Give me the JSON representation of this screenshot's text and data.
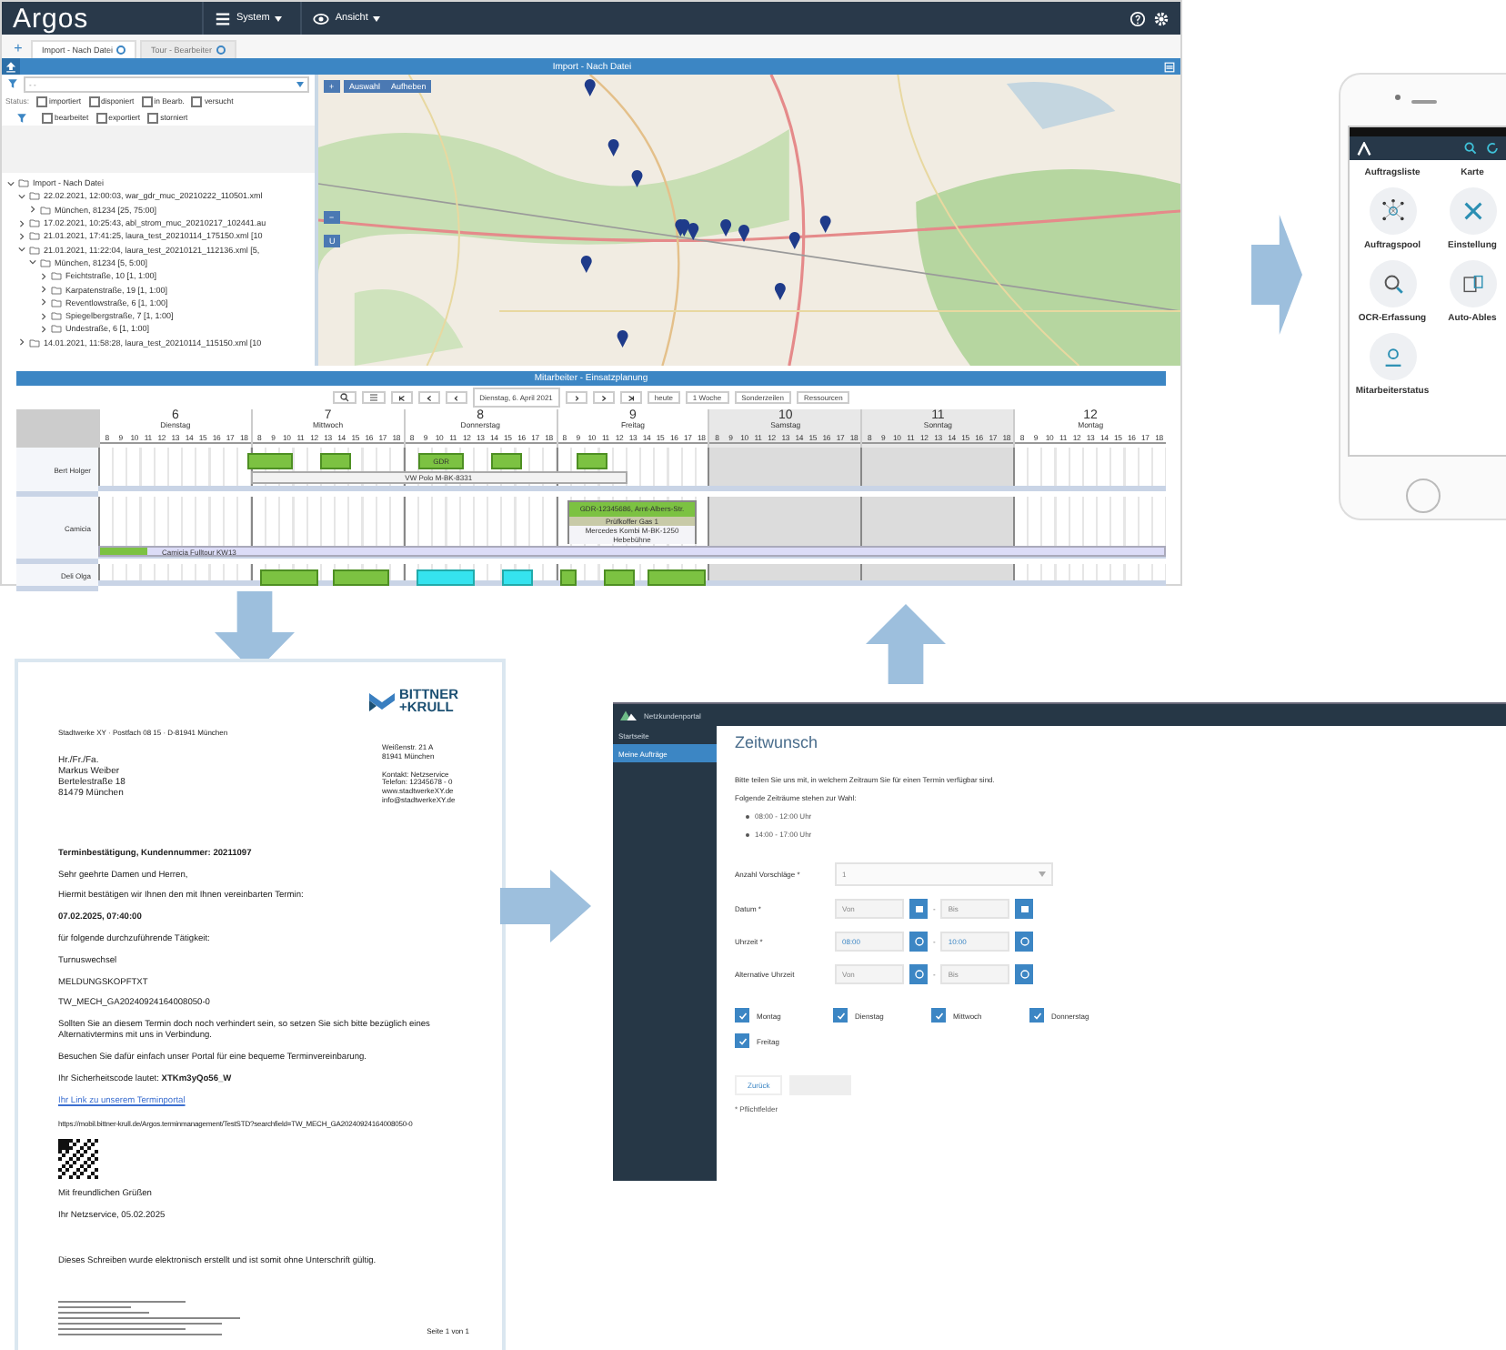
{
  "argos": {
    "logo": "Argos",
    "menus": [
      {
        "label": "System"
      },
      {
        "label": "Ansicht"
      }
    ],
    "add_tab": "+",
    "tabs": [
      {
        "label": "Import - Nach Datei",
        "selected": true
      },
      {
        "label": "Tour - Bearbeiter",
        "selected": false
      }
    ],
    "import_panel": {
      "title": "Import - Nach Datei",
      "filter_value": "- -",
      "status_label": "Status:",
      "statuses": [
        {
          "label": "importiert",
          "checked": false
        },
        {
          "label": "disponiert",
          "checked": false
        },
        {
          "label": "in Bearb.",
          "checked": false
        },
        {
          "label": "versucht",
          "checked": false
        },
        {
          "label": "bearbeitet",
          "checked": false
        },
        {
          "label": "exportiert",
          "checked": false
        },
        {
          "label": "storniert",
          "checked": false
        }
      ],
      "tree": [
        {
          "label": "Import - Nach Datei",
          "expanded": true,
          "children": [
            {
              "label": "22.02.2021, 12:00:03, war_gdr_muc_20210222_110501.xml",
              "expanded": true,
              "children": [
                {
                  "label": "München, 81234 [25, 75:00]",
                  "expanded": false
                }
              ]
            },
            {
              "label": "17.02.2021, 10:25:43, abl_strom_muc_20210217_102441.au",
              "expanded": false
            },
            {
              "label": "21.01.2021, 17:41:25, laura_test_20210114_175150.xml [10",
              "expanded": false
            },
            {
              "label": "21.01.2021, 11:22:04, laura_test_20210121_112136.xml [5,",
              "expanded": true,
              "children": [
                {
                  "label": "München, 81234 [5, 5:00]",
                  "expanded": true,
                  "children": [
                    {
                      "label": "Feichtstraße, 10 [1, 1:00]",
                      "expanded": false
                    },
                    {
                      "label": "Karpatenstraße, 19 [1, 1:00]",
                      "expanded": false
                    },
                    {
                      "label": "Reventlowstraße, 6 [1, 1:00]",
                      "expanded": false
                    },
                    {
                      "label": "Spiegelbergstraße, 7 [1, 1:00]",
                      "expanded": false
                    },
                    {
                      "label": "Undestraße, 6 [1, 1:00]",
                      "expanded": false
                    }
                  ]
                }
              ]
            },
            {
              "label": "14.01.2021, 11:58:28, laura_test_20210114_115150.xml [10",
              "expanded": false
            }
          ]
        }
      ]
    },
    "map": {
      "zoom_in": "+",
      "zoom_out": "−",
      "buttons": [
        "Auswahl",
        "Aufheben"
      ],
      "u_button": "U"
    },
    "planning": {
      "title": "Mitarbeiter - Einsatzplanung",
      "date": "Dienstag, 6. April 2021",
      "buttons": [
        "heute",
        "1 Woche",
        "Sonderzeilen",
        "Ressourcen"
      ],
      "days": [
        {
          "number": "6",
          "name": "Dienstag",
          "weekend": false,
          "hours": [
            "8",
            "9",
            "10",
            "11",
            "12",
            "13",
            "14",
            "15",
            "16",
            "17",
            "18"
          ]
        },
        {
          "number": "7",
          "name": "Mittwoch",
          "weekend": false,
          "hours": [
            "8",
            "9",
            "10",
            "11",
            "12",
            "13",
            "14",
            "15",
            "16",
            "17",
            "18"
          ]
        },
        {
          "number": "8",
          "name": "Donnerstag",
          "weekend": false,
          "hours": [
            "8",
            "9",
            "10",
            "11",
            "12",
            "13",
            "14",
            "15",
            "16",
            "17",
            "18"
          ]
        },
        {
          "number": "9",
          "name": "Freitag",
          "weekend": false,
          "hours": [
            "8",
            "9",
            "10",
            "11",
            "12",
            "13",
            "14",
            "15",
            "16",
            "17",
            "18"
          ]
        },
        {
          "number": "10",
          "name": "Samstag",
          "weekend": true,
          "hours": [
            "8",
            "9",
            "10",
            "11",
            "12",
            "13",
            "14",
            "15",
            "16",
            "17",
            "18"
          ]
        },
        {
          "number": "11",
          "name": "Sonntag",
          "weekend": true,
          "hours": [
            "8",
            "9",
            "10",
            "11",
            "12",
            "13",
            "14",
            "15",
            "16",
            "17",
            "18"
          ]
        },
        {
          "number": "12",
          "name": "Montag",
          "weekend": false,
          "hours": [
            "8",
            "9",
            "10",
            "11",
            "12",
            "13",
            "14",
            "15",
            "16",
            "17",
            "18"
          ]
        }
      ],
      "rows": [
        {
          "name": "Bert Holger",
          "kind": "short",
          "lanes": [
            [
              [
                {
                  "kind": "free"
                },
                {
                  "kind": "free"
                },
                {
                  "kind": "free"
                },
                {
                  "kind": "free"
                },
                {
                  "kind": "free"
                },
                {
                  "kind": "free"
                },
                {
                  "kind": "free"
                },
                {
                  "kind": "free"
                },
                {
                  "kind": "free"
                },
                {
                  "kind": "free"
                },
                {
                  "kind": "free"
                }
              ],
              [
                {
                  "kind": "job"
                },
                {
                  "kind": "job"
                },
                {
                  "kind": "job"
                },
                {
                  "kind": "free"
                },
                {
                  "kind": "free"
                },
                {
                  "kind": "job"
                },
                {
                  "kind": "job"
                },
                {
                  "kind": "free"
                },
                {
                  "kind": "free"
                },
                {
                  "kind": "free"
                },
                {
                  "kind": "free"
                }
              ],
              [
                {
                  "kind": "free"
                },
                {
                  "kind": "job",
                  "label": "GDR"
                },
                {
                  "kind": "job"
                },
                {
                  "kind": "job"
                },
                {
                  "kind": "free"
                },
                {
                  "kind": "free"
                },
                {
                  "kind": "job"
                },
                {
                  "kind": "job"
                },
                {
                  "kind": "free"
                },
                {
                  "kind": "free"
                },
                {
                  "kind": "free"
                }
              ],
              [
                {
                  "kind": "free"
                },
                {
                  "kind": "job"
                },
                {
                  "kind": "job"
                },
                {
                  "kind": "free"
                },
                {
                  "kind": "free"
                },
                {
                  "kind": "free"
                },
                {
                  "kind": "free"
                },
                {
                  "kind": "free"
                },
                {
                  "kind": "free"
                },
                {
                  "kind": "free"
                },
                {
                  "kind": "free"
                }
              ],
              [
                {
                  "kind": "free"
                },
                {
                  "kind": "free"
                },
                {
                  "kind": "free"
                },
                {
                  "kind": "free"
                },
                {
                  "kind": "free"
                },
                {
                  "kind": "free"
                },
                {
                  "kind": "free"
                },
                {
                  "kind": "free"
                },
                {
                  "kind": "free"
                },
                {
                  "kind": "free"
                },
                {
                  "kind": "free"
                }
              ],
              [
                {
                  "kind": "free"
                },
                {
                  "kind": "free"
                },
                {
                  "kind": "free"
                },
                {
                  "kind": "free"
                },
                {
                  "kind": "free"
                },
                {
                  "kind": "free"
                },
                {
                  "kind": "free"
                },
                {
                  "kind": "free"
                },
                {
                  "kind": "free"
                },
                {
                  "kind": "free"
                },
                {
                  "kind": "free"
                }
              ],
              [
                {
                  "kind": "free"
                },
                {
                  "kind": "free"
                },
                {
                  "kind": "free"
                },
                {
                  "kind": "free"
                },
                {
                  "kind": "free"
                },
                {
                  "kind": "free"
                },
                {
                  "kind": "free"
                },
                {
                  "kind": "free"
                },
                {
                  "kind": "free"
                },
                {
                  "kind": "free"
                },
                {
                  "kind": "free"
                }
              ]
            ],
            [
              [
                {
                  "kind": "free"
                },
                {
                  "kind": "free"
                },
                {
                  "kind": "free"
                },
                {
                  "kind": "free"
                },
                {
                  "kind": "free"
                },
                {
                  "kind": "free"
                },
                {
                  "kind": "free"
                },
                {
                  "kind": "free"
                },
                {
                  "kind": "free"
                },
                {
                  "kind": "free"
                },
                {
                  "kind": "free"
                }
              ],
              [
                {
                  "kind": "vehicle",
                  "label": "VW Polo M-BK-8331"
                },
                {
                  "kind": "vehicle"
                },
                {
                  "kind": "vehicle"
                },
                {
                  "kind": "vehicle"
                },
                {
                  "kind": "vehicle"
                },
                {
                  "kind": "vehicle"
                },
                {
                  "kind": "vehicle"
                },
                {
                  "kind": "vehicle"
                },
                {
                  "kind": "vehicle"
                },
                {
                  "kind": "vehicle"
                },
                {
                  "kind": "vehicle"
                }
              ],
              [
                {
                  "kind": "vehicle"
                },
                {
                  "kind": "vehicle"
                },
                {
                  "kind": "vehicle"
                },
                {
                  "kind": "vehicle"
                },
                {
                  "kind": "vehicle"
                },
                {
                  "kind": "vehicle"
                },
                {
                  "kind": "vehicle"
                },
                {
                  "kind": "vehicle"
                },
                {
                  "kind": "vehicle"
                },
                {
                  "kind": "vehicle"
                },
                {
                  "kind": "vehicle"
                }
              ],
              [
                {
                  "kind": "vehicle"
                },
                {
                  "kind": "vehicle"
                },
                {
                  "kind": "vehicle"
                },
                {
                  "kind": "vehicle"
                },
                {
                  "kind": "vehicle"
                },
                {
                  "kind": "free"
                },
                {
                  "kind": "free"
                },
                {
                  "kind": "free"
                },
                {
                  "kind": "free"
                },
                {
                  "kind": "free"
                },
                {
                  "kind": "free"
                }
              ],
              [
                {
                  "kind": "free"
                },
                {
                  "kind": "free"
                },
                {
                  "kind": "free"
                },
                {
                  "kind": "free"
                },
                {
                  "kind": "free"
                },
                {
                  "kind": "free"
                },
                {
                  "kind": "free"
                },
                {
                  "kind": "free"
                },
                {
                  "kind": "free"
                },
                {
                  "kind": "free"
                },
                {
                  "kind": "free"
                }
              ],
              [
                {
                  "kind": "free"
                },
                {
                  "kind": "free"
                },
                {
                  "kind": "free"
                },
                {
                  "kind": "free"
                },
                {
                  "kind": "free"
                },
                {
                  "kind": "free"
                },
                {
                  "kind": "free"
                },
                {
                  "kind": "free"
                },
                {
                  "kind": "free"
                },
                {
                  "kind": "free"
                },
                {
                  "kind": "free"
                }
              ],
              [
                {
                  "kind": "free"
                },
                {
                  "kind": "free"
                },
                {
                  "kind": "free"
                },
                {
                  "kind": "free"
                },
                {
                  "kind": "free"
                },
                {
                  "kind": "free"
                },
                {
                  "kind": "free"
                },
                {
                  "kind": "free"
                },
                {
                  "kind": "free"
                },
                {
                  "kind": "free"
                },
                {
                  "kind": "free"
                }
              ]
            ]
          ]
        },
        {
          "name": "Camicia",
          "kind": "tall",
          "lanes": [
            [
              [
                {
                  "kind": "free"
                },
                {
                  "kind": "free"
                },
                {
                  "kind": "free"
                },
                {
                  "kind": "free"
                },
                {
                  "kind": "free"
                },
                {
                  "kind": "free"
                },
                {
                  "kind": "free"
                },
                {
                  "kind": "free"
                },
                {
                  "kind": "free"
                },
                {
                  "kind": "free"
                },
                {
                  "kind": "free"
                }
              ],
              [
                {
                  "kind": "free"
                },
                {
                  "kind": "free"
                },
                {
                  "kind": "free"
                },
                {
                  "kind": "free"
                },
                {
                  "kind": "free"
                },
                {
                  "kind": "free"
                },
                {
                  "kind": "free"
                },
                {
                  "kind": "free"
                },
                {
                  "kind": "free"
                },
                {
                  "kind": "free"
                },
                {
                  "kind": "free"
                }
              ],
              [
                {
                  "kind": "free"
                },
                {
                  "kind": "free"
                },
                {
                  "kind": "free"
                },
                {
                  "kind": "free"
                },
                {
                  "kind": "free"
                },
                {
                  "kind": "free"
                },
                {
                  "kind": "free"
                },
                {
                  "kind": "free"
                },
                {
                  "kind": "free"
                },
                {
                  "kind": "free"
                },
                {
                  "kind": "free"
                }
              ],
              [
                {
                  "kind": "free"
                },
                {
                  "kind": "order",
                  "label": "GDR-12345686, Arnt-Albers-Str.",
                  "details": [
                    "Prüfkoffer Gas 1",
                    "Mercedes Kombi M-BK-1250",
                    "Hebebühne"
                  ]
                },
                {
                  "kind": "order"
                },
                {
                  "kind": "order"
                },
                {
                  "kind": "order"
                },
                {
                  "kind": "order"
                },
                {
                  "kind": "order"
                },
                {
                  "kind": "order"
                },
                {
                  "kind": "order"
                },
                {
                  "kind": "order"
                },
                {
                  "kind": "free"
                }
              ],
              [
                {
                  "kind": "free"
                },
                {
                  "kind": "free"
                },
                {
                  "kind": "free"
                },
                {
                  "kind": "free"
                },
                {
                  "kind": "free"
                },
                {
                  "kind": "free"
                },
                {
                  "kind": "free"
                },
                {
                  "kind": "free"
                },
                {
                  "kind": "free"
                },
                {
                  "kind": "free"
                },
                {
                  "kind": "free"
                }
              ],
              [
                {
                  "kind": "free"
                },
                {
                  "kind": "free"
                },
                {
                  "kind": "free"
                },
                {
                  "kind": "free"
                },
                {
                  "kind": "free"
                },
                {
                  "kind": "free"
                },
                {
                  "kind": "free"
                },
                {
                  "kind": "free"
                },
                {
                  "kind": "free"
                },
                {
                  "kind": "free"
                },
                {
                  "kind": "free"
                }
              ],
              [
                {
                  "kind": "free"
                },
                {
                  "kind": "free"
                },
                {
                  "kind": "free"
                },
                {
                  "kind": "free"
                },
                {
                  "kind": "free"
                },
                {
                  "kind": "free"
                },
                {
                  "kind": "free"
                },
                {
                  "kind": "free"
                },
                {
                  "kind": "free"
                },
                {
                  "kind": "free"
                },
                {
                  "kind": "free"
                }
              ]
            ],
            [
              [
                {
                  "kind": "tour",
                  "label": "Camicia Fulltour KW13"
                },
                {
                  "kind": "tour"
                },
                {
                  "kind": "tour"
                },
                {
                  "kind": "tour"
                },
                {
                  "kind": "tour"
                },
                {
                  "kind": "tour"
                },
                {
                  "kind": "tour"
                },
                {
                  "kind": "tour"
                },
                {
                  "kind": "tour"
                },
                {
                  "kind": "tour"
                },
                {
                  "kind": "tour"
                }
              ],
              [
                {
                  "kind": "tour"
                },
                {
                  "kind": "tour"
                },
                {
                  "kind": "tour"
                },
                {
                  "kind": "tour"
                },
                {
                  "kind": "tour"
                },
                {
                  "kind": "tour"
                },
                {
                  "kind": "tour"
                },
                {
                  "kind": "tour"
                },
                {
                  "kind": "tour"
                },
                {
                  "kind": "tour"
                },
                {
                  "kind": "tour"
                }
              ],
              [
                {
                  "kind": "tour"
                },
                {
                  "kind": "tour"
                },
                {
                  "kind": "tour"
                },
                {
                  "kind": "tour"
                },
                {
                  "kind": "tour"
                },
                {
                  "kind": "tour"
                },
                {
                  "kind": "tour"
                },
                {
                  "kind": "tour"
                },
                {
                  "kind": "tour"
                },
                {
                  "kind": "tour"
                },
                {
                  "kind": "tour"
                }
              ],
              [
                {
                  "kind": "tour"
                },
                {
                  "kind": "tour"
                },
                {
                  "kind": "tour"
                },
                {
                  "kind": "tour"
                },
                {
                  "kind": "tour"
                },
                {
                  "kind": "tour"
                },
                {
                  "kind": "tour"
                },
                {
                  "kind": "tour"
                },
                {
                  "kind": "tour"
                },
                {
                  "kind": "tour"
                },
                {
                  "kind": "tour"
                }
              ],
              [
                {
                  "kind": "tour"
                },
                {
                  "kind": "tour"
                },
                {
                  "kind": "tour"
                },
                {
                  "kind": "tour"
                },
                {
                  "kind": "tour"
                },
                {
                  "kind": "tour"
                },
                {
                  "kind": "tour"
                },
                {
                  "kind": "tour"
                },
                {
                  "kind": "tour"
                },
                {
                  "kind": "tour"
                },
                {
                  "kind": "tour"
                }
              ],
              [
                {
                  "kind": "tour"
                },
                {
                  "kind": "tour"
                },
                {
                  "kind": "tour"
                },
                {
                  "kind": "tour"
                },
                {
                  "kind": "tour"
                },
                {
                  "kind": "tour"
                },
                {
                  "kind": "tour"
                },
                {
                  "kind": "tour"
                },
                {
                  "kind": "tour"
                },
                {
                  "kind": "tour"
                },
                {
                  "kind": "tour"
                }
              ],
              [
                {
                  "kind": "tour"
                },
                {
                  "kind": "tour"
                },
                {
                  "kind": "tour"
                },
                {
                  "kind": "tour"
                },
                {
                  "kind": "tour"
                },
                {
                  "kind": "tour"
                },
                {
                  "kind": "tour"
                },
                {
                  "kind": "tour"
                },
                {
                  "kind": "tour"
                },
                {
                  "kind": "tour"
                },
                {
                  "kind": "tour"
                }
              ]
            ]
          ]
        },
        {
          "name": "Deli Olga",
          "kind": "cut",
          "lanes": [
            [
              [
                {
                  "kind": "free"
                },
                {
                  "kind": "free"
                },
                {
                  "kind": "free"
                },
                {
                  "kind": "free"
                },
                {
                  "kind": "free"
                },
                {
                  "kind": "free"
                },
                {
                  "kind": "free"
                },
                {
                  "kind": "free"
                },
                {
                  "kind": "free"
                },
                {
                  "kind": "free"
                },
                {
                  "kind": "free"
                }
              ],
              [
                {
                  "kind": "free"
                },
                {
                  "kind": "job"
                },
                {
                  "kind": "job"
                },
                {
                  "kind": "job"
                },
                {
                  "kind": "job"
                },
                {
                  "kind": "free"
                },
                {
                  "kind": "job"
                },
                {
                  "kind": "job"
                },
                {
                  "kind": "job"
                },
                {
                  "kind": "job"
                },
                {
                  "kind": "free"
                }
              ],
              [
                {
                  "kind": "free"
                },
                {
                  "kind": "service"
                },
                {
                  "kind": "service"
                },
                {
                  "kind": "service"
                },
                {
                  "kind": "service"
                },
                {
                  "kind": "free"
                },
                {
                  "kind": "free"
                },
                {
                  "kind": "service"
                },
                {
                  "kind": "service"
                },
                {
                  "kind": "free"
                },
                {
                  "kind": "free"
                }
              ],
              [
                {
                  "kind": "job"
                },
                {
                  "kind": "free"
                },
                {
                  "kind": "free"
                },
                {
                  "kind": "job"
                },
                {
                  "kind": "job"
                },
                {
                  "kind": "free"
                },
                {
                  "kind": "job"
                },
                {
                  "kind": "job"
                },
                {
                  "kind": "job"
                },
                {
                  "kind": "job"
                },
                {
                  "kind": "free"
                }
              ],
              [
                {
                  "kind": "free"
                },
                {
                  "kind": "free"
                },
                {
                  "kind": "free"
                },
                {
                  "kind": "free"
                },
                {
                  "kind": "free"
                },
                {
                  "kind": "free"
                },
                {
                  "kind": "free"
                },
                {
                  "kind": "free"
                },
                {
                  "kind": "free"
                },
                {
                  "kind": "free"
                },
                {
                  "kind": "free"
                }
              ],
              [
                {
                  "kind": "free"
                },
                {
                  "kind": "free"
                },
                {
                  "kind": "free"
                },
                {
                  "kind": "free"
                },
                {
                  "kind": "free"
                },
                {
                  "kind": "free"
                },
                {
                  "kind": "free"
                },
                {
                  "kind": "free"
                },
                {
                  "kind": "free"
                },
                {
                  "kind": "free"
                },
                {
                  "kind": "free"
                }
              ],
              [
                {
                  "kind": "free"
                },
                {
                  "kind": "free"
                },
                {
                  "kind": "free"
                },
                {
                  "kind": "free"
                },
                {
                  "kind": "free"
                },
                {
                  "kind": "free"
                },
                {
                  "kind": "free"
                },
                {
                  "kind": "free"
                },
                {
                  "kind": "free"
                },
                {
                  "kind": "free"
                },
                {
                  "kind": "free"
                }
              ]
            ]
          ]
        }
      ]
    }
  },
  "phone": {
    "tiles": [
      {
        "label": "Auftragsliste",
        "kind": "none"
      },
      {
        "label": "Karte",
        "kind": "none"
      },
      {
        "label": "Auftragspool",
        "kind": "network"
      },
      {
        "label": "Einstellung",
        "kind": "tools"
      },
      {
        "label": "OCR-Erfassung",
        "kind": "ocr"
      },
      {
        "label": "Auto-Ables",
        "kind": "meter"
      },
      {
        "label": "Mitarbeiterstatus",
        "kind": "worker"
      }
    ]
  },
  "letter": {
    "logo": [
      "BITTNER",
      "+KRULL"
    ],
    "sender": "Stadtwerke XY · Postfach 08 15 · D-81941 München",
    "address": [
      "Hr./Fr./Fa.",
      "Markus Weiber",
      "Bertelestraße 18",
      "81479 München"
    ],
    "office": [
      "Weißenstr. 21 A",
      "81941 München"
    ],
    "contact": [
      "Kontakt: Netzservice",
      "Telefon: 12345678 - 0",
      "www.stadtwerkeXY.de",
      "info@stadtwerkeXY.de"
    ],
    "lines": [
      {
        "kind": "bold",
        "text": "Terminbestätigung, Kundennummer: 20211097"
      },
      {
        "kind": "plain",
        "text": "Sehr geehrte Damen und Herren,"
      },
      {
        "kind": "plain",
        "text": "Hiermit bestätigen wir Ihnen den mit Ihnen vereinbarten Termin:"
      },
      {
        "kind": "bold",
        "text": "07.02.2025, 07:40:00"
      },
      {
        "kind": "plain",
        "text": "für folgende durchzuführende Tätigkeit:"
      },
      {
        "kind": "plain",
        "text": "Turnuswechsel"
      },
      {
        "kind": "plain",
        "text": "MELDUNGSKOPFTXT"
      },
      {
        "kind": "plain",
        "text": "TW_MECH_GA20240924164008050-0"
      },
      {
        "kind": "plain",
        "text": "Sollten Sie an diesem Termin doch noch verhindert sein, so setzen Sie sich bitte bezüglich eines Alternativtermins mit uns in Verbindung."
      },
      {
        "kind": "plain",
        "text": "Besuchen Sie dafür einfach unser Portal für eine bequeme Terminvereinbarung."
      },
      {
        "kind": "rich",
        "text": "Ihr Sicherheitscode lautet: **XTKm3yQo56_W**"
      },
      {
        "kind": "link",
        "text": "Ihr Link zu unserem Terminportal"
      },
      {
        "kind": "url",
        "text": "https://mobil.bittner-krull.de/Argos.terminmanagement/TestSTD?searchfield=TW_MECH_GA20240924164008050-0"
      },
      {
        "kind": "qr"
      },
      {
        "kind": "plain",
        "text": "Mit freundlichen Grüßen"
      },
      {
        "kind": "plain",
        "text": "Ihr Netzservice, 05.02.2025"
      },
      {
        "kind": "gap"
      },
      {
        "kind": "plain",
        "text": "Dieses Schreiben wurde elektronisch erstellt und ist somit ohne Unterschrift gültig."
      }
    ],
    "page": "Seite 1 von 1"
  },
  "portal": {
    "title": "Netzkundenportal",
    "nav": [
      {
        "label": "Startseite",
        "selected": false
      },
      {
        "label": "Meine Aufträge",
        "selected": true
      }
    ],
    "heading": "Zeitwunsch",
    "intro": "Bitte teilen Sie uns mit, in welchem Zeitraum Sie für einen Termin verfügbar sind.",
    "choices_label": "Folgende Zeiträume stehen zur Wahl:",
    "choices": [
      "08:00 - 12:00 Uhr",
      "14:00 - 17:00 Uhr"
    ],
    "fields": [
      {
        "kind": "select",
        "label": "Anzahl Vorschläge *",
        "value": "1"
      },
      {
        "kind": "range",
        "label": "Datum *",
        "from": {
          "placeholder": "Von"
        },
        "separator": "-",
        "to": {
          "placeholder": "Bis"
        }
      },
      {
        "kind": "range",
        "label": "Uhrzeit *",
        "from": {
          "value": "08:00"
        },
        "separator": "-",
        "to": {
          "value": "10:00"
        }
      },
      {
        "kind": "range",
        "label": "Alternative Uhrzeit",
        "from": {
          "placeholder": "Von"
        },
        "separator": "-",
        "to": {
          "placeholder": "Bis"
        }
      }
    ],
    "weekdays": [
      {
        "label": "Montag",
        "checked": true
      },
      {
        "label": "Dienstag",
        "checked": true
      },
      {
        "label": "Mittwoch",
        "checked": true
      },
      {
        "label": "Donnerstag",
        "checked": true
      },
      {
        "label": "Freitag",
        "checked": true
      }
    ],
    "back": "Zurück",
    "next": {
      "disabled": true
    },
    "required_note": "* Pflichtfelder"
  }
}
